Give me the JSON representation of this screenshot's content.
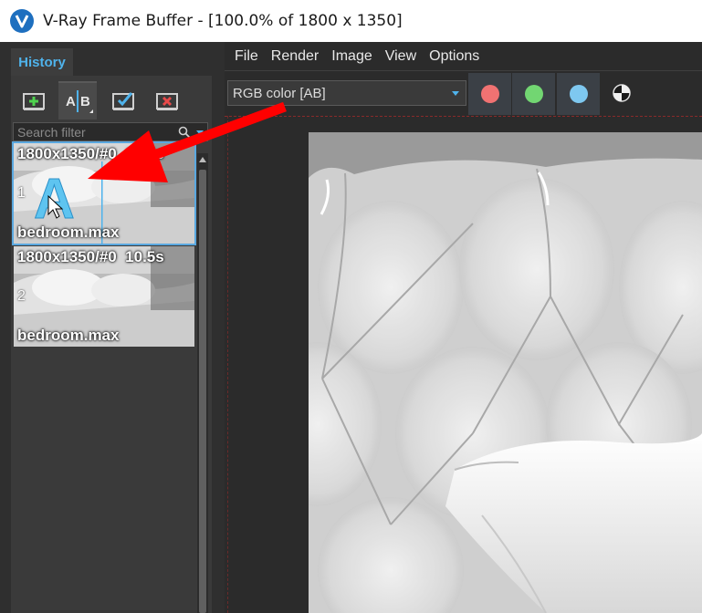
{
  "window": {
    "title": "V-Ray Frame Buffer - [100.0% of 1800 x 1350]",
    "app_icon": "vray-logo-icon"
  },
  "history": {
    "tab_label": "History",
    "toolbar": {
      "icons": [
        "add-history-icon",
        "ab-compare-icon",
        "set-a-icon",
        "delete-history-icon"
      ]
    },
    "search": {
      "placeholder": "Search filter"
    },
    "items": [
      {
        "index": "1",
        "info": "1800x1350/#0  10.5s",
        "file": "bedroom.max",
        "selected": true
      },
      {
        "index": "2",
        "info": "1800x1350/#0  10.5s",
        "file": "bedroom.max",
        "selected": false
      }
    ],
    "ab_overlay_letter": "A"
  },
  "menu": {
    "items": [
      "File",
      "Render",
      "Image",
      "View",
      "Options"
    ]
  },
  "toolbar": {
    "channel": "RGB color [AB]",
    "channel_buttons": [
      {
        "name": "red-channel",
        "color": "#f07272"
      },
      {
        "name": "green-channel",
        "color": "#72d672"
      },
      {
        "name": "blue-channel",
        "color": "#7ec8f0"
      }
    ],
    "mono_icon": "monochrome-icon"
  },
  "colors": {
    "accent": "#4fb3ec",
    "annotation_arrow": "#ff0000"
  }
}
